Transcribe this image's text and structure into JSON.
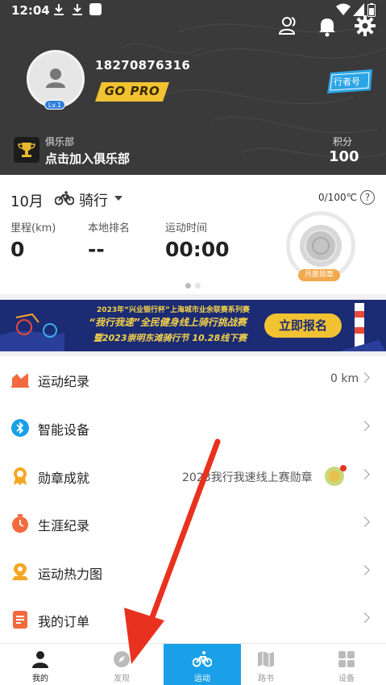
{
  "status_bar": {
    "time": "12:04"
  },
  "profile": {
    "level": "Lv.1",
    "phone": "18270876316",
    "pro_badge": "GO PRO",
    "rider_tag": "行者号"
  },
  "club": {
    "label": "俱乐部",
    "join_text": "点击加入俱乐部"
  },
  "points": {
    "label": "积分",
    "value": "100"
  },
  "stats": {
    "month": "10月",
    "sport": "骑行",
    "goal": "0/100℃",
    "mileage_label": "里程(km)",
    "mileage_value": "0",
    "rank_label": "本地排名",
    "rank_value": "--",
    "time_label": "运动时间",
    "time_value": "00:00",
    "medal_label": "月度勋章"
  },
  "banner": {
    "line1": "2023年“兴业银行杯”上海城市业余联赛系列赛",
    "line2": "“我行我速”全民健身线上骑行挑战赛",
    "line3": "暨2023崇明东滩骑行节 10.28线下赛",
    "cta": "立即报名"
  },
  "menu": [
    {
      "label": "运动纪录",
      "value": "0 km",
      "icon": "chart-icon",
      "color": "#f26a3d"
    },
    {
      "label": "智能设备",
      "value": "",
      "icon": "bluetooth-icon",
      "color": "#1aa0e8"
    },
    {
      "label": "勋章成就",
      "value": "2023我行我速线上赛勋章",
      "icon": "medal-icon",
      "color": "#f5a623"
    },
    {
      "label": "生涯纪录",
      "value": "",
      "icon": "stopwatch-icon",
      "color": "#f26a3d"
    },
    {
      "label": "运动热力图",
      "value": "",
      "icon": "location-icon",
      "color": "#f5a623"
    },
    {
      "label": "我的订单",
      "value": "",
      "icon": "order-icon",
      "color": "#f26a3d"
    }
  ],
  "bottom_nav": [
    {
      "label": "我的",
      "icon": "person-icon"
    },
    {
      "label": "发现",
      "icon": "compass-icon"
    },
    {
      "label": "运动",
      "icon": "bike-icon"
    },
    {
      "label": "路书",
      "icon": "map-icon"
    },
    {
      "label": "设备",
      "icon": "grid-icon"
    }
  ],
  "colors": {
    "accent": "#1aa0e8",
    "header_bg": "#3a3a3a",
    "gold": "#f1c232",
    "arrow": "#e8321f"
  }
}
